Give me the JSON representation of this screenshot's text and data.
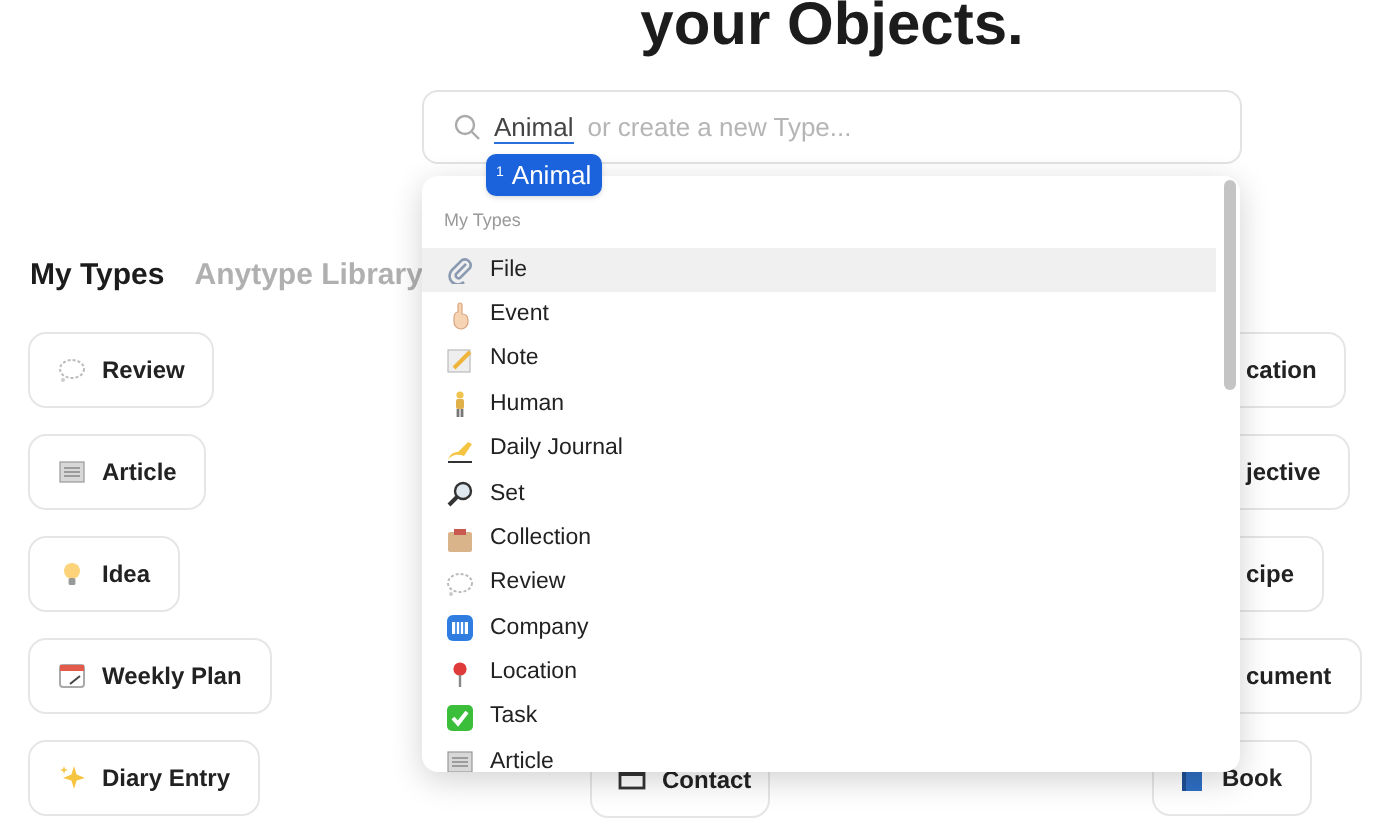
{
  "heading": "your Objects.",
  "search": {
    "value": "Animal",
    "placeholder": "or create a new Type..."
  },
  "ime_candidate": {
    "index": "1",
    "text": "Animal"
  },
  "tabs": [
    {
      "label": "My Types",
      "selected": true
    },
    {
      "label": "Anytype Library",
      "selected": false
    }
  ],
  "cards_left": [
    "Review",
    "Article",
    "Idea",
    "Weekly Plan",
    "Diary Entry"
  ],
  "cards_middle": [
    "Contact"
  ],
  "cards_right": [
    "cation",
    "jective",
    "cipe",
    "cument",
    "Book"
  ],
  "dropdown": {
    "section": "My Types",
    "items": [
      {
        "label": "File",
        "selected": true
      },
      {
        "label": "Event",
        "selected": false
      },
      {
        "label": "Note",
        "selected": false
      },
      {
        "label": "Human",
        "selected": false
      },
      {
        "label": "Daily Journal",
        "selected": false
      },
      {
        "label": "Set",
        "selected": false
      },
      {
        "label": "Collection",
        "selected": false
      },
      {
        "label": "Review",
        "selected": false
      },
      {
        "label": "Company",
        "selected": false
      },
      {
        "label": "Location",
        "selected": false
      },
      {
        "label": "Task",
        "selected": false
      },
      {
        "label": "Article",
        "selected": false
      }
    ]
  }
}
